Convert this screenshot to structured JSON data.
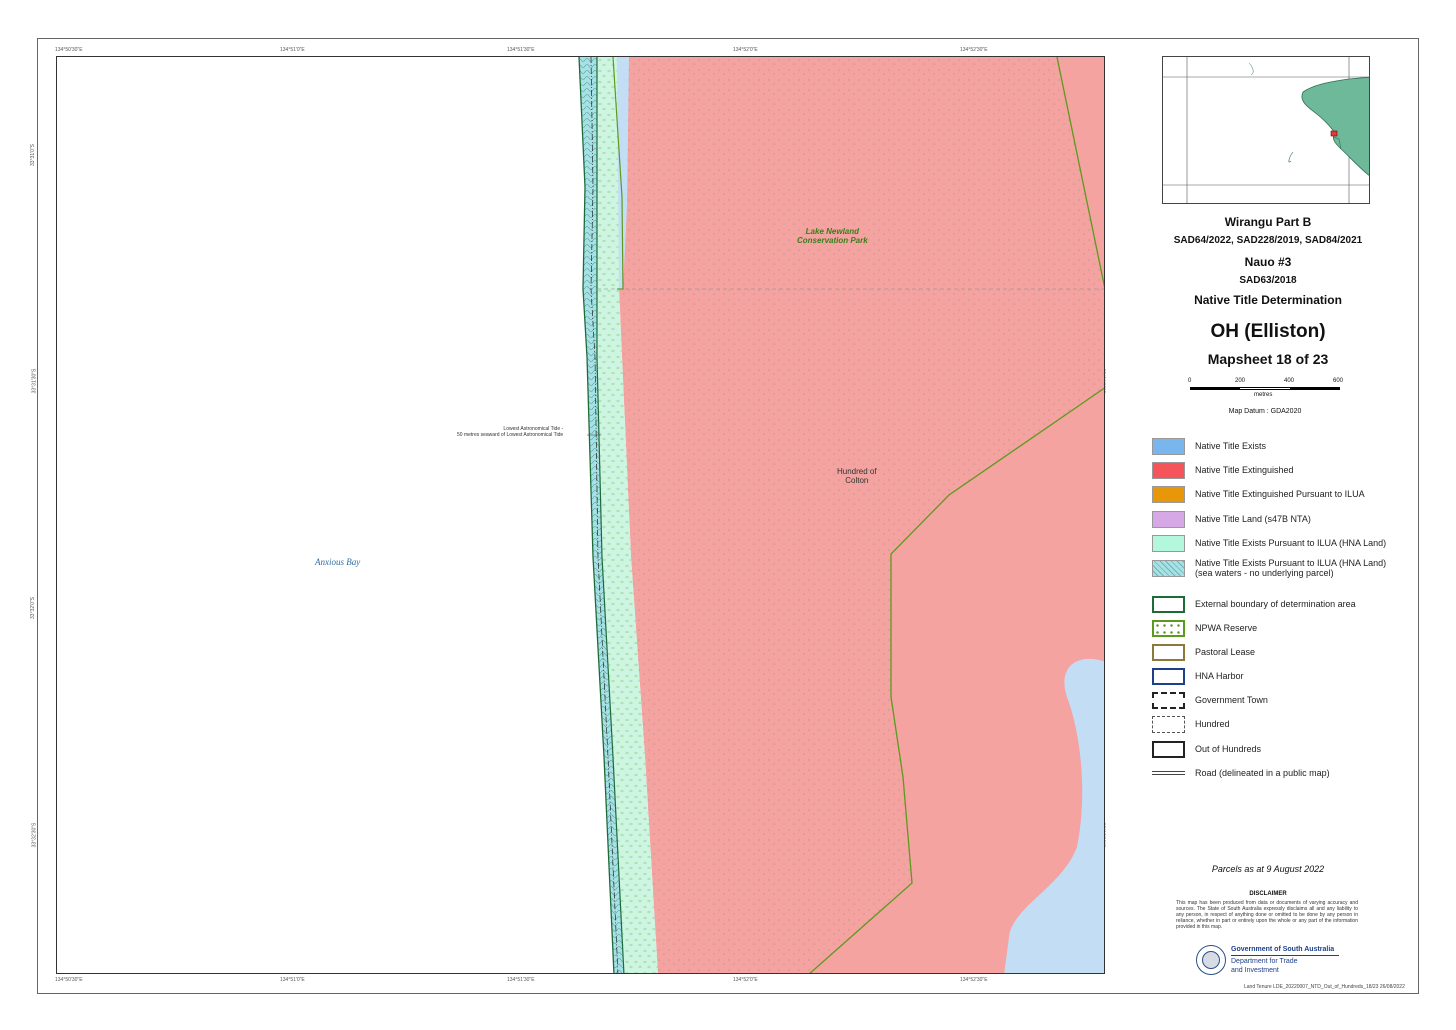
{
  "map": {
    "labels": {
      "lake_newland": "Lake Newland\nConservation Park",
      "anxious_bay": "Anxious Bay",
      "hundred": "Hundred of\nColton",
      "tide_note": "Lowest Astronomical Tide -\n50 metres seaward of Lowest Astronomical Tide"
    },
    "ticks_top": [
      "134°50'30\"E",
      "134°51'0\"E",
      "134°51'30\"E",
      "134°52'0\"E",
      "134°52'30\"E"
    ],
    "ticks_bottom": [
      "134°50'30\"E",
      "134°51'0\"E",
      "134°51'30\"E",
      "134°52'0\"E",
      "134°52'30\"E"
    ],
    "ticks_left": [
      "33°31'0\"S",
      "33°31'30\"S",
      "33°32'0\"S",
      "33°32'30\"S"
    ],
    "ticks_right": [
      "33°31'0\"S",
      "33°31'30\"S",
      "33°32'0\"S",
      "33°32'30\"S"
    ],
    "colors": {
      "extinguished": "#f4a3a0",
      "exists": "#c3ddf5",
      "hna_land": "#cdf5e2",
      "sea_hatch": "#a8e1e3",
      "boundary": "#1e6b3a",
      "reserve": "#5c9a1e"
    }
  },
  "titles": {
    "line1": "Wirangu Part B",
    "line2": "SAD64/2022, SAD228/2019, SAD84/2021",
    "line3": "Nauo #3",
    "line4": "SAD63/2018",
    "line5": "Native Title Determination",
    "main": "OH (Elliston)",
    "sheet": "Mapsheet 18 of 23"
  },
  "scale": {
    "ticks": [
      "0",
      "200",
      "400",
      "600"
    ],
    "unit": "metres",
    "datum": "Map Datum : GDA2020"
  },
  "legend": [
    {
      "label": "Native Title Exists",
      "color": "#79b6ee",
      "style": "fill"
    },
    {
      "label": "Native Title Extinguished",
      "color": "#f5545a",
      "style": "fill"
    },
    {
      "label": "Native Title Extinguished Pursuant to ILUA",
      "color": "#e8960a",
      "style": "fill"
    },
    {
      "label": "Native Title Land (s47B NTA)",
      "color": "#d7a8e6",
      "style": "fill"
    },
    {
      "label": "Native Title Exists Pursuant to ILUA (HNA Land)",
      "color": "#b3f7dc",
      "style": "fill"
    },
    {
      "label": "Native Title Exists Pursuant to ILUA (HNA Land)\n(sea waters - no underlying parcel)",
      "color": "#a8e1e3",
      "style": "hatch"
    },
    {
      "label": "External boundary of determination area",
      "color": "#1e6b3a",
      "style": "outline"
    },
    {
      "label": "NPWA Reserve",
      "color": "#5c9a1e",
      "style": "dots"
    },
    {
      "label": "Pastoral Lease",
      "color": "#8b7a3a",
      "style": "outline"
    },
    {
      "label": "HNA Harbor",
      "color": "#1e3f8a",
      "style": "outline"
    },
    {
      "label": "Government Town",
      "color": "#222222",
      "style": "dashdot"
    },
    {
      "label": "Hundred",
      "color": "#555555",
      "style": "dashed"
    },
    {
      "label": "Out of Hundreds",
      "color": "#222222",
      "style": "outline"
    },
    {
      "label": "Road (delineated in a public map)",
      "color": "#444444",
      "style": "road"
    }
  ],
  "parcels_note": "Parcels as at 9 August 2022",
  "disclaimer": {
    "title": "DISCLAIMER",
    "text": "This map has been produced from data or documents of varying accuracy and sources. The State of South Australia expressly disclaims all and any liability to any person, in respect of anything done or omitted to be done by any person in reliance, whether in part or entirely upon the whole or any part of the information provided in this map."
  },
  "government": {
    "line1": "Government of South Australia",
    "line2": "Department for Trade",
    "line3": "and Investment"
  },
  "file_ref": "Land Tenure LDE_20220007_NTD_Out_of_Hundreds_18/23  26/08/2022"
}
